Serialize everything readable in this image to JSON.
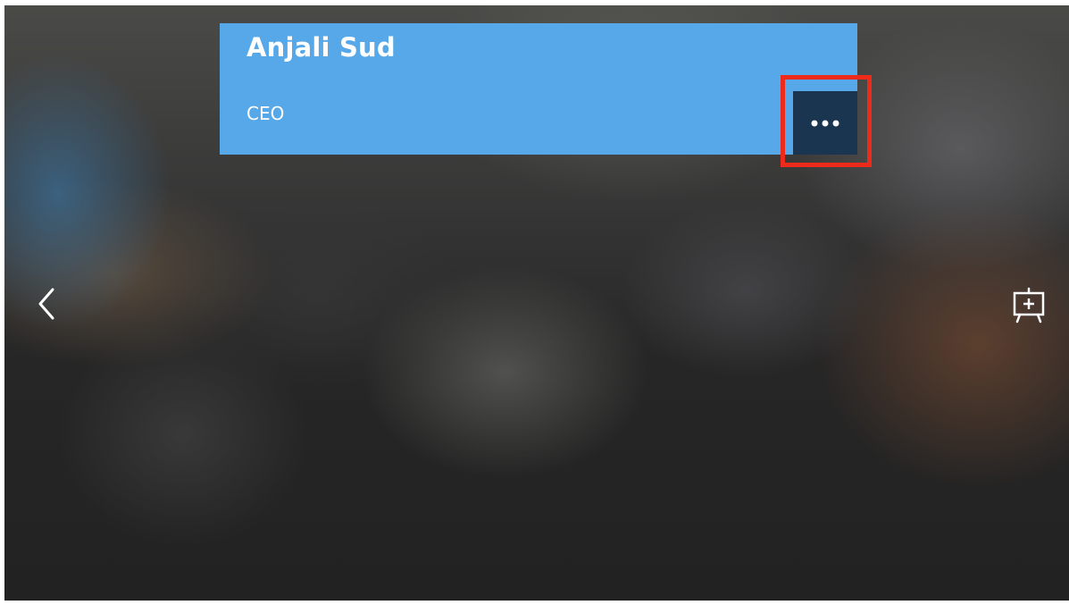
{
  "card": {
    "name": "Anjali Sud",
    "title": "CEO",
    "accent_color": "#56a8e8"
  },
  "more_button": {
    "icon": "more-horizontal-icon",
    "color": "#193550",
    "highlighted": true,
    "highlight_color": "#ee2a1b"
  },
  "navigation": {
    "back_icon": "chevron-left-icon",
    "board_icon": "add-to-board-icon"
  }
}
